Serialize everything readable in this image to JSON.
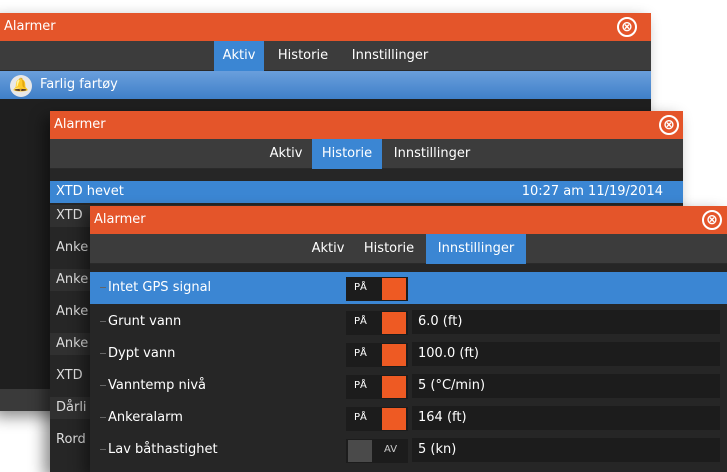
{
  "dialog1": {
    "title": "Alarmer",
    "close_icon": "⊗",
    "tabs": [
      "Aktiv",
      "Historie",
      "Innstillinger"
    ],
    "active_alarm": "Farlig fartøy"
  },
  "dialog2": {
    "title": "Alarmer",
    "close_icon": "⊗",
    "tabs": [
      "Aktiv",
      "Historie",
      "Innstillinger"
    ],
    "rows": [
      {
        "text": "XTD hevet",
        "time": "10:27 am 11/19/2014"
      },
      {
        "text": "XTD"
      },
      {
        "text": "Anke"
      },
      {
        "text": "Anke"
      },
      {
        "text": "Anke"
      },
      {
        "text": "Anke"
      },
      {
        "text": "XTD"
      },
      {
        "text": "Dårli"
      },
      {
        "text": "Rord"
      }
    ]
  },
  "dialog3": {
    "title": "Alarmer",
    "close_icon": "⊗",
    "tabs": [
      "Aktiv",
      "Historie",
      "Innstillinger"
    ],
    "settings": [
      {
        "label": "Intet GPS signal",
        "state": "PÅ",
        "value": ""
      },
      {
        "label": "Grunt vann",
        "state": "PÅ",
        "value": "6.0 (ft)"
      },
      {
        "label": "Dypt vann",
        "state": "PÅ",
        "value": "100.0 (ft)"
      },
      {
        "label": "Vanntemp nivå",
        "state": "PÅ",
        "value": "5 (°C/min)"
      },
      {
        "label": "Ankeralarm",
        "state": "PÅ",
        "value": "164 (ft)"
      },
      {
        "label": "Lav båthastighet",
        "state": "AV",
        "value": "5 (kn)"
      }
    ]
  }
}
